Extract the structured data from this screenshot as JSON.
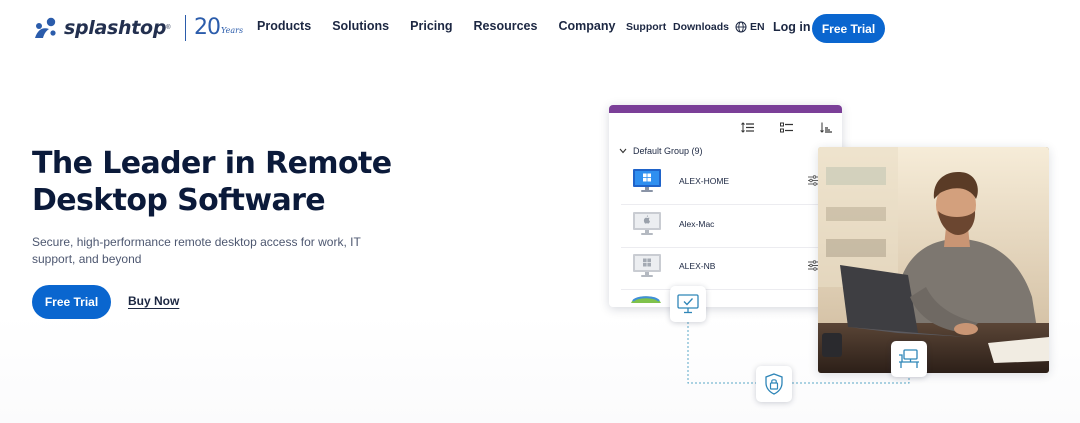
{
  "brand": {
    "name": "splashtop",
    "anniversary_number": "20",
    "anniversary_word": "Years",
    "color": "#0a66cf"
  },
  "nav": {
    "items": [
      {
        "label": "Products"
      },
      {
        "label": "Solutions"
      },
      {
        "label": "Pricing"
      },
      {
        "label": "Resources"
      },
      {
        "label": "Company"
      }
    ],
    "support": "Support",
    "downloads": "Downloads",
    "language": "EN",
    "login": "Log in",
    "cta": "Free Trial"
  },
  "hero": {
    "title_line1": "The Leader in Remote",
    "title_line2": "Desktop Software",
    "subtitle": "Secure, high-performance remote desktop access for work, IT support, and beyond",
    "primary_cta": "Free Trial",
    "secondary_cta": "Buy Now"
  },
  "app": {
    "header_color": "#7b3f98",
    "group_label": "Default Group (9)",
    "devices": [
      {
        "name": "ALEX-HOME",
        "icon": "windows-monitor-icon",
        "online": true
      },
      {
        "name": "Alex-Mac",
        "icon": "mac-monitor-icon",
        "online": false
      },
      {
        "name": "ALEX-NB",
        "icon": "windows-laptop-icon",
        "online": false
      }
    ]
  },
  "badges": [
    {
      "icon": "monitor-check-icon"
    },
    {
      "icon": "shield-lock-icon"
    },
    {
      "icon": "desk-icon"
    }
  ]
}
